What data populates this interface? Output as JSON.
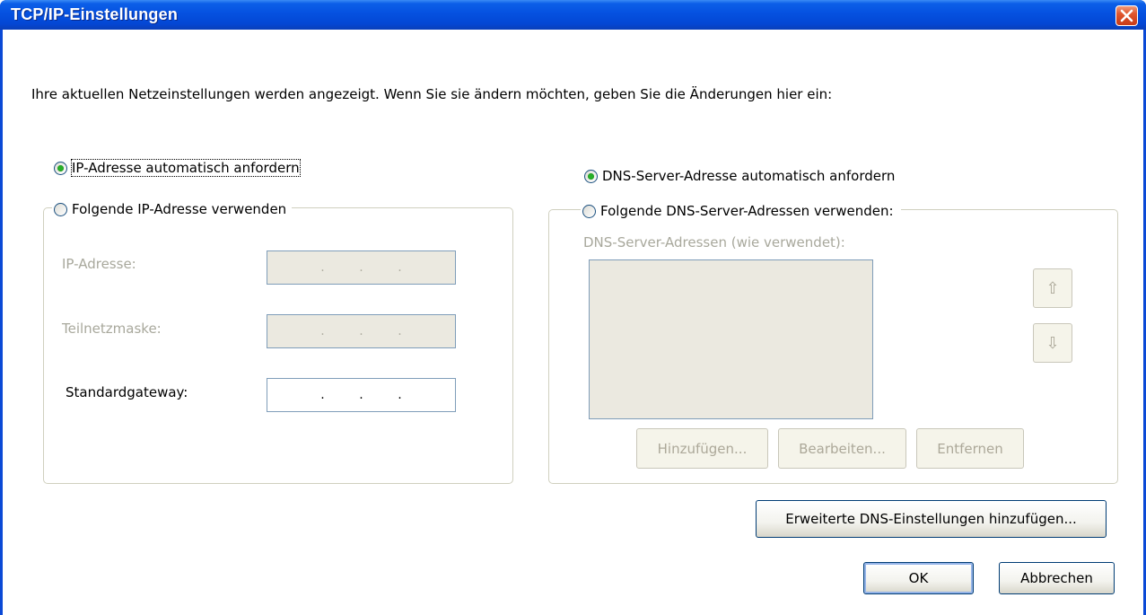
{
  "window": {
    "title": "TCP/IP-Einstellungen"
  },
  "intro_text": "Ihre aktuellen Netzeinstellungen werden angezeigt. Wenn Sie sie ändern möchten, geben Sie die Änderungen hier ein:",
  "ip": {
    "auto_label": "IP-Adresse automatisch anfordern",
    "auto_selected": true,
    "manual_label": "Folgende IP-Adresse verwenden",
    "fields": [
      {
        "label": "IP-Adresse:",
        "value": " .  .  . ",
        "enabled": false
      },
      {
        "label": "Teilnetzmaske:",
        "value": " .  .  . ",
        "enabled": false
      },
      {
        "label": "Standardgateway:",
        "value": " .  .  . ",
        "enabled": true
      }
    ]
  },
  "dns": {
    "auto_label": "DNS-Server-Adresse automatisch anfordern",
    "auto_selected": true,
    "manual_label": "Folgende DNS-Server-Adressen verwenden:",
    "list_label": "DNS-Server-Adressen (wie verwendet):",
    "list_items": [],
    "up_icon": "arrow-up-icon",
    "down_icon": "arrow-down-icon",
    "add_button": "Hinzufügen...",
    "edit_button": "Bearbeiten...",
    "remove_button": "Entfernen"
  },
  "advanced_button": "Erweiterte DNS-Einstellungen hinzufügen...",
  "ok_button": "OK",
  "cancel_button": "Abbrechen",
  "colors": {
    "titlebar": "#0551e0",
    "close": "#e0562e",
    "radio_checked": "#28b028",
    "disabled_text": "#a8a89c"
  }
}
